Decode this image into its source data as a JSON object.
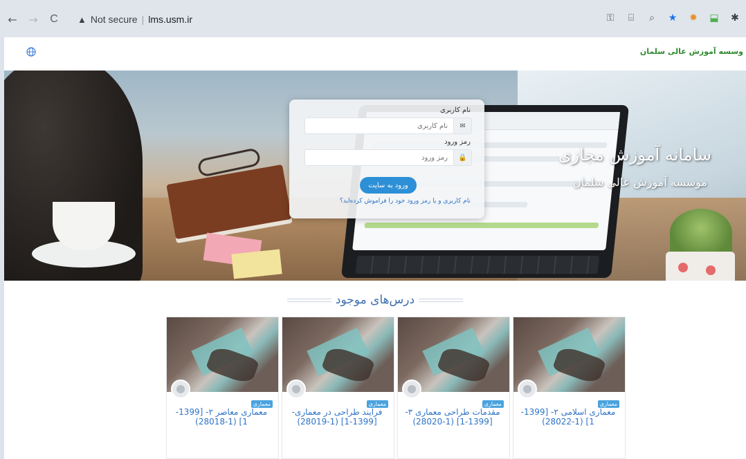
{
  "browser": {
    "back_label": "←",
    "forward_label": "→",
    "reload_label": "C",
    "warning_text": "Not secure",
    "host": "lms.usm.ir"
  },
  "nav": {
    "site_name": "وسسه آموزش عالی سلمان"
  },
  "hero": {
    "title": "سامانه آموزش مجازی",
    "subtitle": "موسسه آموزش عالی سلمان"
  },
  "login": {
    "username_label": "نام کاربری",
    "username_placeholder": "نام کاربری",
    "password_label": "رمز ورود",
    "password_placeholder": "رمز ورود",
    "submit_label": "ورود به سایت",
    "forgot_link": "نام کاربری و یا رمز ورود خود را فراموش کرده‌اید؟"
  },
  "courses": {
    "heading": "درس‌های موجود",
    "items": [
      {
        "category": "معماری",
        "name": "معماری اسلامی ۲- [1399-1] (1-28022)"
      },
      {
        "category": "معماری",
        "name": "مقدمات طراحی معماری ۳- [1399-1] (1-28020)"
      },
      {
        "category": "معماری",
        "name": "فرآیند طراحی در معماری- [1399-1] (1-28019)"
      },
      {
        "category": "معماری",
        "name": "معماری معاصر ۲- [1399-1] (1-28018)"
      }
    ]
  },
  "colors": {
    "link_blue": "#2d73c8",
    "button_blue": "#2d8fd6",
    "site_green": "#2f8a2f"
  }
}
